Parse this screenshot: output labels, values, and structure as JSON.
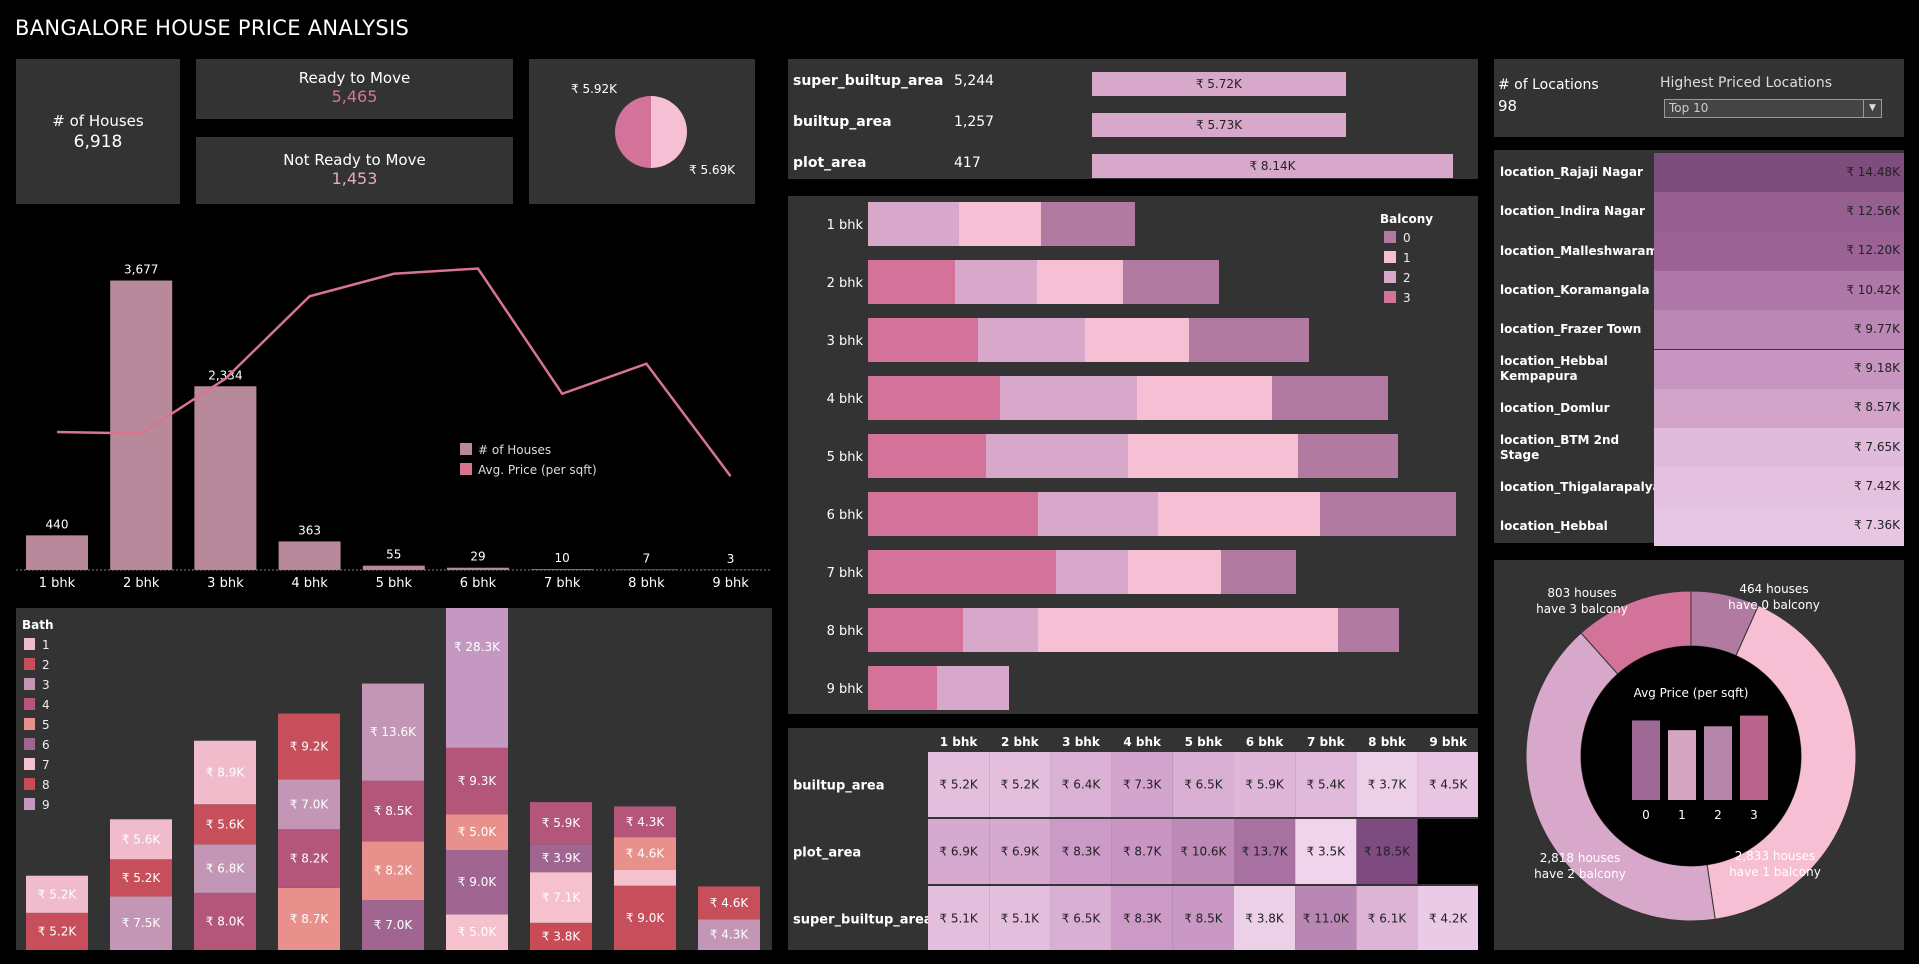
{
  "header": {
    "title": "BANGALORE HOUSE PRICE ANALYSIS"
  },
  "kpi": {
    "houses_label": "# of Houses",
    "houses_value": "6,918",
    "ready_label": "Ready to Move",
    "ready_value": "5,465",
    "notready_label": "Not Ready to Move",
    "notready_value": "1,453",
    "pie_label_top": "₹ 5.92K",
    "pie_label_bottom": "₹ 5.69K"
  },
  "colors": {
    "pink": "#d4739a",
    "lightpink": "#f7bfd3",
    "mauve": "#b07aa1",
    "lilac": "#d8a8ca",
    "bar": "#b8899a",
    "line": "#d8758e"
  },
  "area": {
    "rows": [
      {
        "label": "super_builtup_area",
        "count": "5,244",
        "price": "₹ 5.72K",
        "price_value": 5.72
      },
      {
        "label": "builtup_area",
        "count": "1,257",
        "price": "₹ 5.73K",
        "price_value": 5.73
      },
      {
        "label": "plot_area",
        "count": "417",
        "price": "₹ 8.14K",
        "price_value": 8.14
      }
    ]
  },
  "locations": {
    "count_label": "# of Locations",
    "count_value": "98",
    "filter_title": "Highest Priced Locations",
    "filter_value": "Top 10",
    "items": [
      {
        "name": "location_Rajaji Nagar",
        "price": "₹ 14.48K",
        "color": "#7d4d7c"
      },
      {
        "name": "location_Indira Nagar",
        "price": "₹ 12.56K",
        "color": "#955f8f"
      },
      {
        "name": "location_Malleshwaram",
        "price": "₹ 12.20K",
        "color": "#9a6394"
      },
      {
        "name": "location_Koramangala",
        "price": "₹ 10.42K",
        "color": "#ae79a8"
      },
      {
        "name": "location_Frazer Town",
        "price": "₹ 9.77K",
        "color": "#bb87b4"
      },
      {
        "name": "location_Hebbal Kempapura",
        "price": "₹ 9.18K",
        "color": "#c795bf"
      },
      {
        "name": "location_Domlur",
        "price": "₹ 8.57K",
        "color": "#d2a4ca"
      },
      {
        "name": "location_BTM 2nd Stage",
        "price": "₹ 7.65K",
        "color": "#e0bbdb"
      },
      {
        "name": "location_Thigalarapalya",
        "price": "₹ 7.42K",
        "color": "#e4c2df"
      },
      {
        "name": "location_Hebbal",
        "price": "₹ 7.36K",
        "color": "#e6c6e2"
      }
    ]
  },
  "chart_data": [
    {
      "type": "bar",
      "name": "bhk",
      "categories": [
        "1 bhk",
        "2 bhk",
        "3 bhk",
        "4 bhk",
        "5 bhk",
        "6 bhk",
        "7 bhk",
        "8 bhk",
        "9 bhk"
      ],
      "series": [
        {
          "name": "# of Houses",
          "values": [
            440,
            3677,
            2334,
            363,
            55,
            29,
            10,
            7,
            3
          ],
          "labels": [
            "440",
            "3,677",
            "2,334",
            "363",
            "55",
            "29",
            "10",
            "7",
            "3"
          ]
        },
        {
          "name": "Avg. Price (per sqft)",
          "values": [
            5.84,
            5.82,
            6.55,
            7.65,
            7.95,
            8.02,
            6.35,
            6.75,
            5.25
          ]
        }
      ],
      "legend": [
        "# of Houses",
        "Avg. Price (per sqft)"
      ]
    },
    {
      "type": "stacked-bar",
      "name": "bath",
      "legend_title": "Bath",
      "legend": [
        "1",
        "2",
        "3",
        "4",
        "5",
        "6",
        "7",
        "8",
        "9"
      ],
      "legend_colors": [
        "#f0bccb",
        "#c74f5c",
        "#c496b6",
        "#b4567a",
        "#e8918c",
        "#a06590",
        "#f4c1cc",
        "#c84b56",
        "#c498c0"
      ],
      "stacks": [
        [
          {
            "label": "₹ 5.2K",
            "value": 5.2,
            "color": "#c74f5c"
          },
          {
            "label": "₹ 5.2K",
            "value": 5.2,
            "color": "#f0bccb"
          }
        ],
        [
          {
            "label": "₹ 7.5K",
            "value": 7.5,
            "color": "#c496b6"
          },
          {
            "label": "₹ 5.2K",
            "value": 5.2,
            "color": "#c74f5c"
          },
          {
            "label": "₹ 5.6K",
            "value": 5.6,
            "color": "#f0bccb"
          }
        ],
        [
          {
            "label": "₹ 8.0K",
            "value": 8.0,
            "color": "#b4567a"
          },
          {
            "label": "₹ 6.8K",
            "value": 6.8,
            "color": "#c496b6"
          },
          {
            "label": "₹ 5.6K",
            "value": 5.6,
            "color": "#c74f5c"
          },
          {
            "label": "₹ 8.9K",
            "value": 8.9,
            "color": "#f0bccb"
          }
        ],
        [
          {
            "label": "₹ 8.7K",
            "value": 8.7,
            "color": "#e8918c"
          },
          {
            "label": "₹ 8.2K",
            "value": 8.2,
            "color": "#b4567a"
          },
          {
            "label": "₹ 7.0K",
            "value": 7.0,
            "color": "#c496b6"
          },
          {
            "label": "₹ 9.2K",
            "value": 9.2,
            "color": "#c74f5c"
          }
        ],
        [
          {
            "label": "₹ 7.0K",
            "value": 7.0,
            "color": "#a06590"
          },
          {
            "label": "₹ 8.2K",
            "value": 8.2,
            "color": "#e8918c"
          },
          {
            "label": "₹ 8.5K",
            "value": 8.5,
            "color": "#b4567a"
          },
          {
            "label": "₹ 13.6K",
            "value": 13.6,
            "color": "#c496b6"
          }
        ],
        [
          {
            "label": "₹ 5.0K",
            "value": 5.0,
            "color": "#f4c1cc"
          },
          {
            "label": "₹ 9.0K",
            "value": 9.0,
            "color": "#a06590"
          },
          {
            "label": "₹ 5.0K",
            "value": 5.0,
            "color": "#e8918c"
          },
          {
            "label": "₹ 9.3K",
            "value": 9.3,
            "color": "#b4567a"
          },
          {
            "label": "₹ 28.3K",
            "value": 28.3,
            "color": "#c498c0"
          }
        ],
        [
          {
            "label": "₹ 3.8K",
            "value": 3.8,
            "color": "#c84b56"
          },
          {
            "label": "₹ 7.1K",
            "value": 7.1,
            "color": "#f4c1cc"
          },
          {
            "label": "₹ 3.9K",
            "value": 3.9,
            "color": "#a06590"
          },
          {
            "label": "₹ 5.9K",
            "value": 5.9,
            "color": "#b4567a"
          }
        ],
        [
          {
            "label": "₹ 9.0K",
            "value": 9.0,
            "color": "#c74f5c"
          },
          {
            "label": "",
            "value": 2.2,
            "color": "#f4c1cc"
          },
          {
            "label": "₹ 4.6K",
            "value": 4.6,
            "color": "#e8918c"
          },
          {
            "label": "₹ 4.3K",
            "value": 4.3,
            "color": "#b4567a"
          }
        ],
        [
          {
            "label": "₹ 4.3K",
            "value": 4.3,
            "color": "#c496b6"
          },
          {
            "label": "₹ 4.6K",
            "value": 4.6,
            "color": "#c74f5c"
          }
        ]
      ]
    },
    {
      "type": "stacked-hbar",
      "name": "balcony",
      "legend_title": "Balcony",
      "legend": [
        "0",
        "1",
        "2",
        "3"
      ],
      "legend_colors": [
        "#b07aa1",
        "#f7bfd3",
        "#d8a8ca",
        "#d4739a"
      ],
      "rows": [
        {
          "label": "1 bhk",
          "segments": [
            {
              "value": 91,
              "color": "#d8a8ca"
            },
            {
              "value": 82,
              "color": "#f7bfd3"
            },
            {
              "value": 94,
              "color": "#b07aa1"
            }
          ]
        },
        {
          "label": "2 bhk",
          "segments": [
            {
              "value": 87,
              "color": "#d4739a"
            },
            {
              "value": 82,
              "color": "#d8a8ca"
            },
            {
              "value": 86,
              "color": "#f7bfd3"
            },
            {
              "value": 96,
              "color": "#b07aa1"
            }
          ]
        },
        {
          "label": "3 bhk",
          "segments": [
            {
              "value": 110,
              "color": "#d4739a"
            },
            {
              "value": 107,
              "color": "#d8a8ca"
            },
            {
              "value": 104,
              "color": "#f7bfd3"
            },
            {
              "value": 120,
              "color": "#b07aa1"
            }
          ]
        },
        {
          "label": "4 bhk",
          "segments": [
            {
              "value": 132,
              "color": "#d4739a"
            },
            {
              "value": 137,
              "color": "#d8a8ca"
            },
            {
              "value": 135,
              "color": "#f7bfd3"
            },
            {
              "value": 116,
              "color": "#b07aa1"
            }
          ]
        },
        {
          "label": "5 bhk",
          "segments": [
            {
              "value": 118,
              "color": "#d4739a"
            },
            {
              "value": 142,
              "color": "#d8a8ca"
            },
            {
              "value": 170,
              "color": "#f7bfd3"
            },
            {
              "value": 100,
              "color": "#b07aa1"
            }
          ]
        },
        {
          "label": "6 bhk",
          "segments": [
            {
              "value": 170,
              "color": "#d4739a"
            },
            {
              "value": 120,
              "color": "#d8a8ca"
            },
            {
              "value": 162,
              "color": "#f7bfd3"
            },
            {
              "value": 136,
              "color": "#b07aa1"
            }
          ]
        },
        {
          "label": "7 bhk",
          "segments": [
            {
              "value": 188,
              "color": "#d4739a"
            },
            {
              "value": 72,
              "color": "#d8a8ca"
            },
            {
              "value": 93,
              "color": "#f7bfd3"
            },
            {
              "value": 75,
              "color": "#b07aa1"
            }
          ]
        },
        {
          "label": "8 bhk",
          "segments": [
            {
              "value": 95,
              "color": "#d4739a"
            },
            {
              "value": 75,
              "color": "#d8a8ca"
            },
            {
              "value": 300,
              "color": "#f7bfd3"
            },
            {
              "value": 61,
              "color": "#b07aa1"
            }
          ]
        },
        {
          "label": "9 bhk",
          "segments": [
            {
              "value": 69,
              "color": "#d4739a"
            },
            {
              "value": 72,
              "color": "#d8a8ca"
            }
          ]
        }
      ]
    },
    {
      "type": "heatmap",
      "name": "area-bhk",
      "columns": [
        "1 bhk",
        "2 bhk",
        "3 bhk",
        "4 bhk",
        "5 bhk",
        "6 bhk",
        "7 bhk",
        "8 bhk",
        "9 bhk"
      ],
      "rows": [
        {
          "label": "builtup_area",
          "cells": [
            {
              "t": "₹ 5.2K",
              "c": "#e3bedd"
            },
            {
              "t": "₹ 5.2K",
              "c": "#e3bedd"
            },
            {
              "t": "₹ 6.4K",
              "c": "#dab0d4"
            },
            {
              "t": "₹ 7.3K",
              "c": "#d3a4cd"
            },
            {
              "t": "₹ 6.5K",
              "c": "#d9afd3"
            },
            {
              "t": "₹ 5.9K",
              "c": "#dfb6d8"
            },
            {
              "t": "₹ 5.4K",
              "c": "#e1badb"
            },
            {
              "t": "₹ 3.7K",
              "c": "#ecd0e8"
            },
            {
              "t": "₹ 4.5K",
              "c": "#e8c6e3"
            }
          ]
        },
        {
          "label": "plot_area",
          "cells": [
            {
              "t": "₹ 6.9K",
              "c": "#d6a9d0"
            },
            {
              "t": "₹ 6.9K",
              "c": "#d6a9d0"
            },
            {
              "t": "₹ 8.3K",
              "c": "#cc9ac6"
            },
            {
              "t": "₹ 8.7K",
              "c": "#c996c3"
            },
            {
              "t": "₹ 10.6K",
              "c": "#bd89b7"
            },
            {
              "t": "₹ 13.7K",
              "c": "#a771a1"
            },
            {
              "t": "₹ 3.5K",
              "c": "#efd4eb"
            },
            {
              "t": "₹ 18.5K",
              "c": "#7e4b80"
            },
            {
              "t": "",
              "c": "#000000"
            }
          ]
        },
        {
          "label": "super_builtup_area",
          "cells": [
            {
              "t": "₹ 5.1K",
              "c": "#e3bedd"
            },
            {
              "t": "₹ 5.1K",
              "c": "#e3bedd"
            },
            {
              "t": "₹ 6.5K",
              "c": "#d9afd3"
            },
            {
              "t": "₹ 8.3K",
              "c": "#cc9ac6"
            },
            {
              "t": "₹ 8.5K",
              "c": "#ca98c4"
            },
            {
              "t": "₹ 3.8K",
              "c": "#ecd0e8"
            },
            {
              "t": "₹ 11.0K",
              "c": "#b987b3"
            },
            {
              "t": "₹ 6.1K",
              "c": "#ddb4d6"
            },
            {
              "t": "₹ 4.2K",
              "c": "#eacbe5"
            }
          ]
        }
      ]
    },
    {
      "type": "pie",
      "name": "balcony-donut",
      "title": "Avg Price (per sqft)",
      "slices": [
        {
          "label": "0",
          "houses": 464,
          "color": "#b07aa1"
        },
        {
          "label": "1",
          "houses": 2833,
          "color": "#f7bfd3"
        },
        {
          "label": "2",
          "houses": 2818,
          "color": "#d8a8ca"
        },
        {
          "label": "3",
          "houses": 803,
          "color": "#d4739a"
        }
      ],
      "annotations": [
        [
          "464 houses",
          "have 0 balcony"
        ],
        [
          "2,833 houses",
          "have 1 balcony"
        ],
        [
          "2,818 houses",
          "have 2 balcony"
        ],
        [
          "803 houses",
          "have 3 balcony"
        ]
      ],
      "bars": {
        "categories": [
          "0",
          "1",
          "2",
          "3"
        ],
        "values": [
          0.82,
          0.72,
          0.76,
          0.87
        ],
        "colors": [
          "#9e6995",
          "#d5a6bf",
          "#b585aa",
          "#b9648a"
        ]
      }
    }
  ]
}
